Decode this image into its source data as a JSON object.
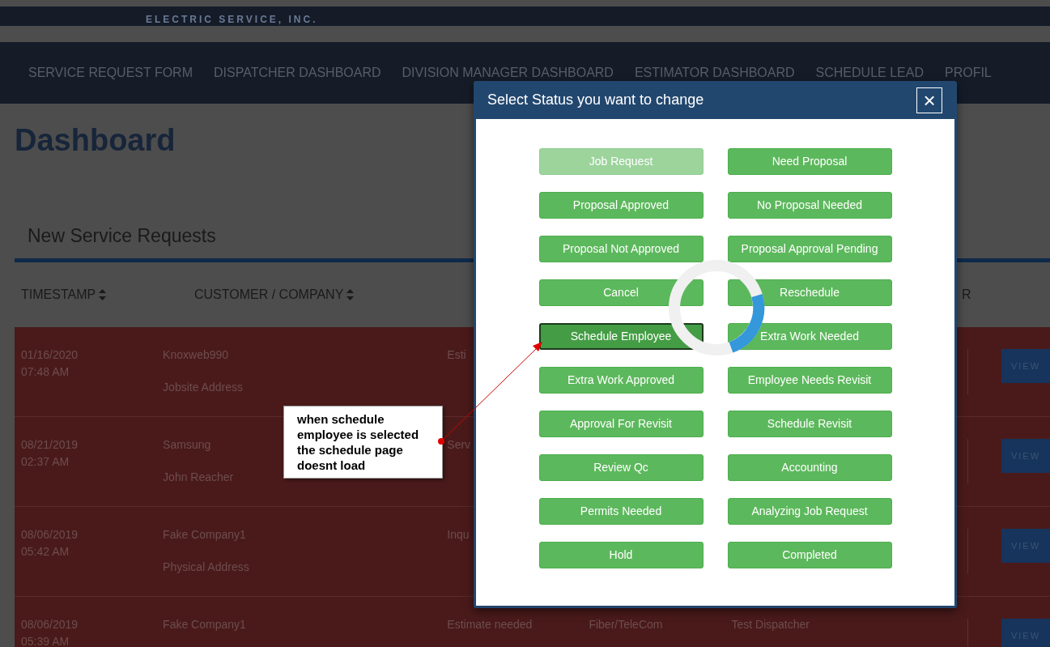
{
  "header": {
    "logo_text": "ELECTRIC SERVICE, INC."
  },
  "nav": [
    "SERVICE REQUEST FORM",
    "DISPATCHER DASHBOARD",
    "DIVISION MANAGER DASHBOARD",
    "ESTIMATOR DASHBOARD",
    "SCHEDULE LEAD",
    "PROFIL"
  ],
  "page_title": "Dashboard",
  "section_title": "New Service Requests",
  "table": {
    "columns": [
      {
        "label": "TIMESTAMP",
        "sortable": true
      },
      {
        "label": "CUSTOMER / COMPANY",
        "sortable": true
      },
      {
        "label": "R",
        "sortable": false
      }
    ],
    "rows": [
      {
        "date": "01/16/2020",
        "time": "07:48 AM",
        "customer": "Knoxweb990",
        "address": "Jobsite Address",
        "column_3": "Esti",
        "column_4": "",
        "column_5": "",
        "action": "VIEW"
      },
      {
        "date": "08/21/2019",
        "time": "02:37 AM",
        "customer": "Samsung",
        "address": "John Reacher",
        "column_3": "Serv",
        "column_4": "",
        "column_5": "",
        "action": "VIEW"
      },
      {
        "date": "08/06/2019",
        "time": "05:42 AM",
        "customer": "Fake Company1",
        "address": "Physical Address",
        "column_3": "Inqu",
        "column_4": "",
        "column_5": "",
        "action": "VIEW"
      },
      {
        "date": "08/06/2019",
        "time": "05:39 AM",
        "customer": "Fake Company1",
        "address": "",
        "column_3": "Estimate needed",
        "column_4": "Fiber/TeleCom",
        "column_5": "Test Dispatcher",
        "action": "VIEW"
      }
    ]
  },
  "modal": {
    "title": "Select Status you want to change",
    "close": "×",
    "loading": true,
    "statuses": [
      {
        "label": "Job Request",
        "selected": false,
        "disabled": true
      },
      {
        "label": "Need Proposal",
        "selected": false,
        "disabled": false
      },
      {
        "label": "Proposal Approved",
        "selected": false,
        "disabled": false
      },
      {
        "label": "No Proposal Needed",
        "selected": false,
        "disabled": false
      },
      {
        "label": "Proposal Not Approved",
        "selected": false,
        "disabled": false
      },
      {
        "label": "Proposal Approval Pending",
        "selected": false,
        "disabled": false
      },
      {
        "label": "Cancel",
        "selected": false,
        "disabled": false
      },
      {
        "label": "Reschedule",
        "selected": false,
        "disabled": false
      },
      {
        "label": "Schedule Employee",
        "selected": true,
        "disabled": false
      },
      {
        "label": "Extra Work Needed",
        "selected": false,
        "disabled": false
      },
      {
        "label": "Extra Work Approved",
        "selected": false,
        "disabled": false
      },
      {
        "label": "Employee Needs Revisit",
        "selected": false,
        "disabled": false
      },
      {
        "label": "Approval For Revisit",
        "selected": false,
        "disabled": false
      },
      {
        "label": "Schedule Revisit",
        "selected": false,
        "disabled": false
      },
      {
        "label": "Review Qc",
        "selected": false,
        "disabled": false
      },
      {
        "label": "Accounting",
        "selected": false,
        "disabled": false
      },
      {
        "label": "Permits Needed",
        "selected": false,
        "disabled": false
      },
      {
        "label": "Analyzing Job Request",
        "selected": false,
        "disabled": false
      },
      {
        "label": "Hold",
        "selected": false,
        "disabled": false
      },
      {
        "label": "Completed",
        "selected": false,
        "disabled": false
      }
    ]
  },
  "annotation": {
    "text": "when schedule employee is selected the schedule page doesnt load"
  }
}
